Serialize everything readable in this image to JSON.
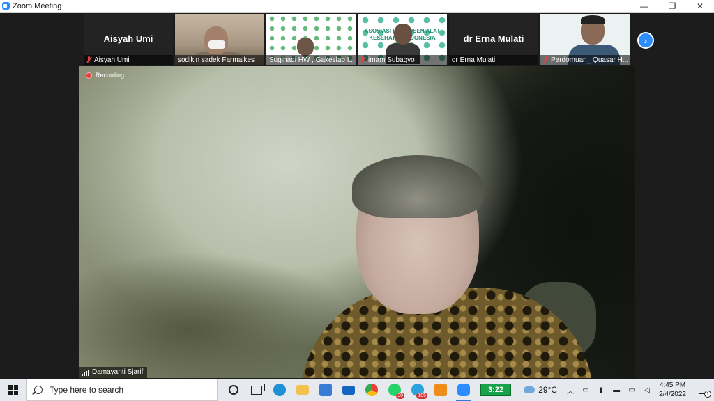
{
  "window": {
    "title": "Zoom Meeting",
    "controls": {
      "minimize": "—",
      "restore": "❐",
      "close": "✕"
    }
  },
  "participants": [
    {
      "name": "Aisyah Umi",
      "display_name": "Aisyah Umi",
      "video": false,
      "muted": true
    },
    {
      "name": "sodikin sadek Farmalkes",
      "video": true,
      "muted": false
    },
    {
      "name": "Sugihadi HW , Gakeslab I...",
      "video": true,
      "muted": false
    },
    {
      "name": "imam Subagyo",
      "video": true,
      "muted": true,
      "background_text": "ASOSIASI PRODUSEN ALAT KESEHATAN INDONESIA"
    },
    {
      "name": "dr Erna Mulati",
      "display_name": "dr Erna Mulati",
      "video": false,
      "muted": false
    },
    {
      "name": "Pardomuan_ Quasar H...",
      "video": true,
      "muted": true
    }
  ],
  "strip": {
    "next_icon": "chevron-right-icon",
    "next_glyph": "›"
  },
  "main": {
    "recording_label": "Recording",
    "speaker_name": "Damayanti Sjarif"
  },
  "taskbar": {
    "search_placeholder": "Type here to search",
    "apps": [
      {
        "name": "cortana",
        "icon": "cortana-icon"
      },
      {
        "name": "task-view",
        "icon": "task-view-icon"
      },
      {
        "name": "edge",
        "icon": "edge-icon",
        "color": "#1f8fd6"
      },
      {
        "name": "file-explorer",
        "icon": "folder-icon",
        "color": "#f2c14e"
      },
      {
        "name": "store",
        "icon": "store-icon",
        "color": "#3a7bd5"
      },
      {
        "name": "mail",
        "icon": "mail-icon",
        "color": "#1565c0"
      },
      {
        "name": "chrome",
        "icon": "chrome-icon",
        "color": "#e94235"
      },
      {
        "name": "whatsapp",
        "icon": "whatsapp-icon",
        "color": "#25d366",
        "badge": "30"
      },
      {
        "name": "telegram",
        "icon": "telegram-icon",
        "color": "#2aa3df",
        "badge": "185"
      },
      {
        "name": "orange-app",
        "icon": "app-icon",
        "color": "#f08c1a"
      },
      {
        "name": "zoom",
        "icon": "zoom-icon",
        "color": "#2d8cff",
        "active": true
      }
    ],
    "battery_time": "3:22",
    "weather": "29°C",
    "clock": {
      "time": "4:45 PM",
      "date": "2/4/2022"
    },
    "notification_count": "1"
  }
}
